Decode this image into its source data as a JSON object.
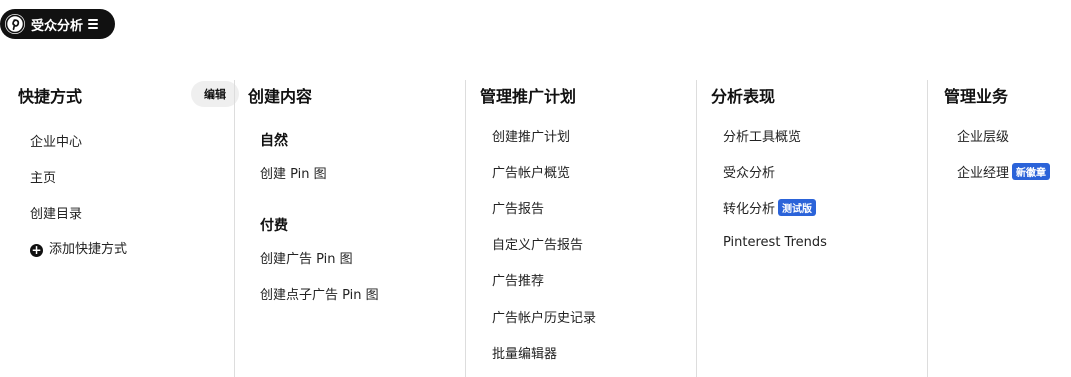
{
  "header": {
    "title": "受众分析"
  },
  "shortcuts": {
    "title": "快捷方式",
    "edit_label": "编辑",
    "items": [
      "企业中心",
      "主页",
      "创建目录"
    ],
    "add_label": "添加快捷方式"
  },
  "create": {
    "title": "创建内容",
    "organic_label": "自然",
    "organic_items": [
      "创建 Pin 图"
    ],
    "paid_label": "付费",
    "paid_items": [
      "创建广告 Pin 图",
      "创建点子广告 Pin 图"
    ]
  },
  "ads": {
    "title": "管理推广计划",
    "items": [
      "创建推广计划",
      "广告帐户概览",
      "广告报告",
      "自定义广告报告",
      "广告推荐",
      "广告帐户历史记录",
      "批量编辑器"
    ]
  },
  "analytics": {
    "title": "分析表现",
    "items": [
      "分析工具概览",
      "受众分析",
      "转化分析",
      "Pinterest Trends"
    ],
    "beta_badge": "测试版"
  },
  "business": {
    "title": "管理业务",
    "items": [
      "企业层级",
      "企业经理"
    ],
    "new_badge": "新徽章"
  },
  "colors": {
    "badge": "#2b63d9",
    "pill": "#111111"
  }
}
